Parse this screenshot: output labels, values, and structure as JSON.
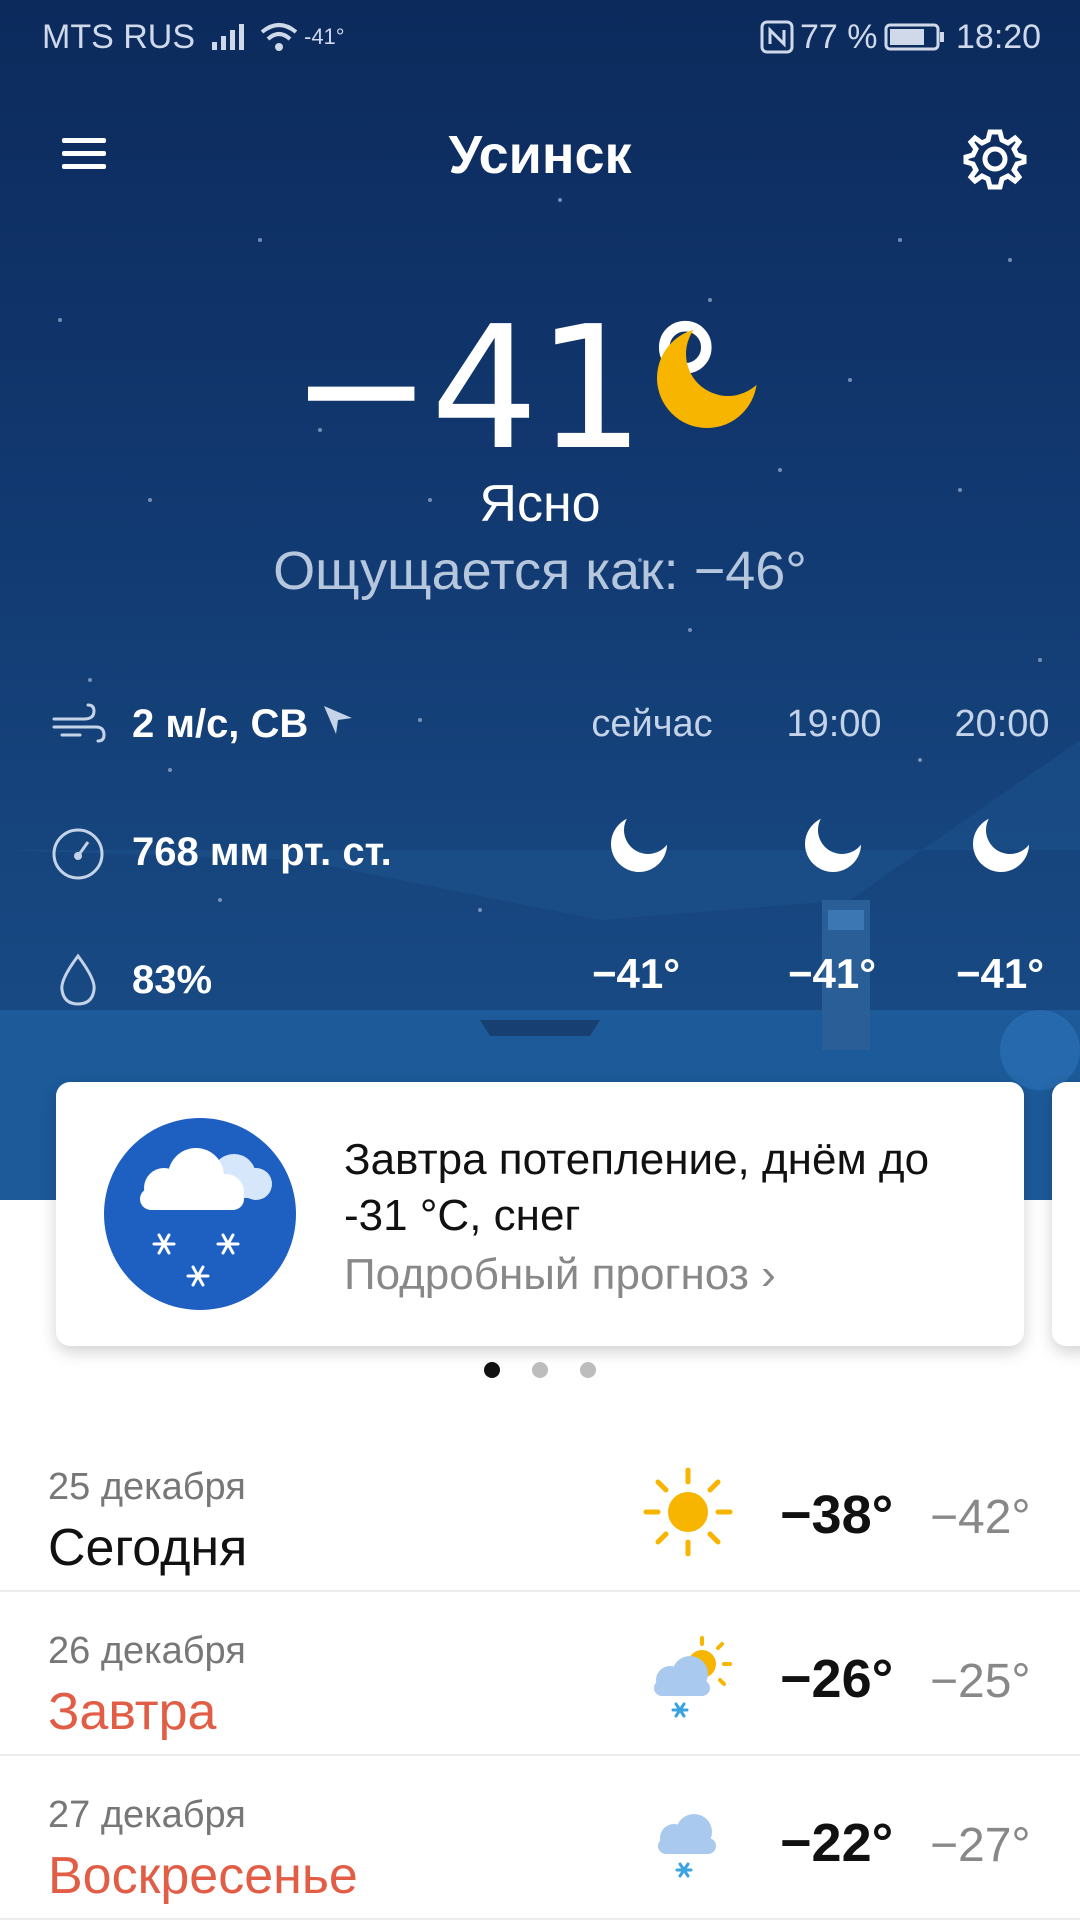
{
  "status_bar": {
    "carrier": "MTS RUS",
    "wifi_temp": "-41°",
    "battery": "77 %",
    "time": "18:20"
  },
  "header": {
    "city": "Усинск",
    "menu_icon": "hamburger-menu-icon",
    "settings_icon": "gear-icon"
  },
  "current": {
    "temperature": "−41°",
    "condition": "Ясно",
    "feels_like": "Ощущается как: −46°",
    "icon": "moon-icon"
  },
  "details": {
    "wind": "2 м/с, СВ",
    "pressure": "768 мм рт. ст.",
    "humidity": "83%"
  },
  "hourly": [
    {
      "label": "сейчас",
      "temp": "−41°",
      "icon": "moon-icon"
    },
    {
      "label": "19:00",
      "temp": "−41°",
      "icon": "moon-icon"
    },
    {
      "label": "20:00",
      "temp": "−41°",
      "icon": "moon-icon"
    }
  ],
  "alert_card": {
    "title": "Завтра потепление, днём до -31 °С, снег",
    "link": "Подробный прогноз  ›",
    "icon": "cloud-snow-icon"
  },
  "pager": {
    "count": 3,
    "active": 1
  },
  "days": [
    {
      "date": "25 декабря",
      "name": "Сегодня",
      "max": "−38°",
      "min": "−42°",
      "icon": "sun-icon",
      "weekend": false
    },
    {
      "date": "26 декабря",
      "name": "Завтра",
      "max": "−26°",
      "min": "−25°",
      "icon": "cloud-sun-snow-icon",
      "weekend": true
    },
    {
      "date": "27 декабря",
      "name": "Воскресенье",
      "max": "−22°",
      "min": "−27°",
      "icon": "cloud-snow-icon",
      "weekend": true
    }
  ],
  "colors": {
    "hero_top": "#0c2a5c",
    "hero_bottom": "#1a4f8a",
    "weekend_red": "#e15d45",
    "sun_yellow": "#f7b500",
    "card_icon_blue": "#1e5fc2"
  }
}
